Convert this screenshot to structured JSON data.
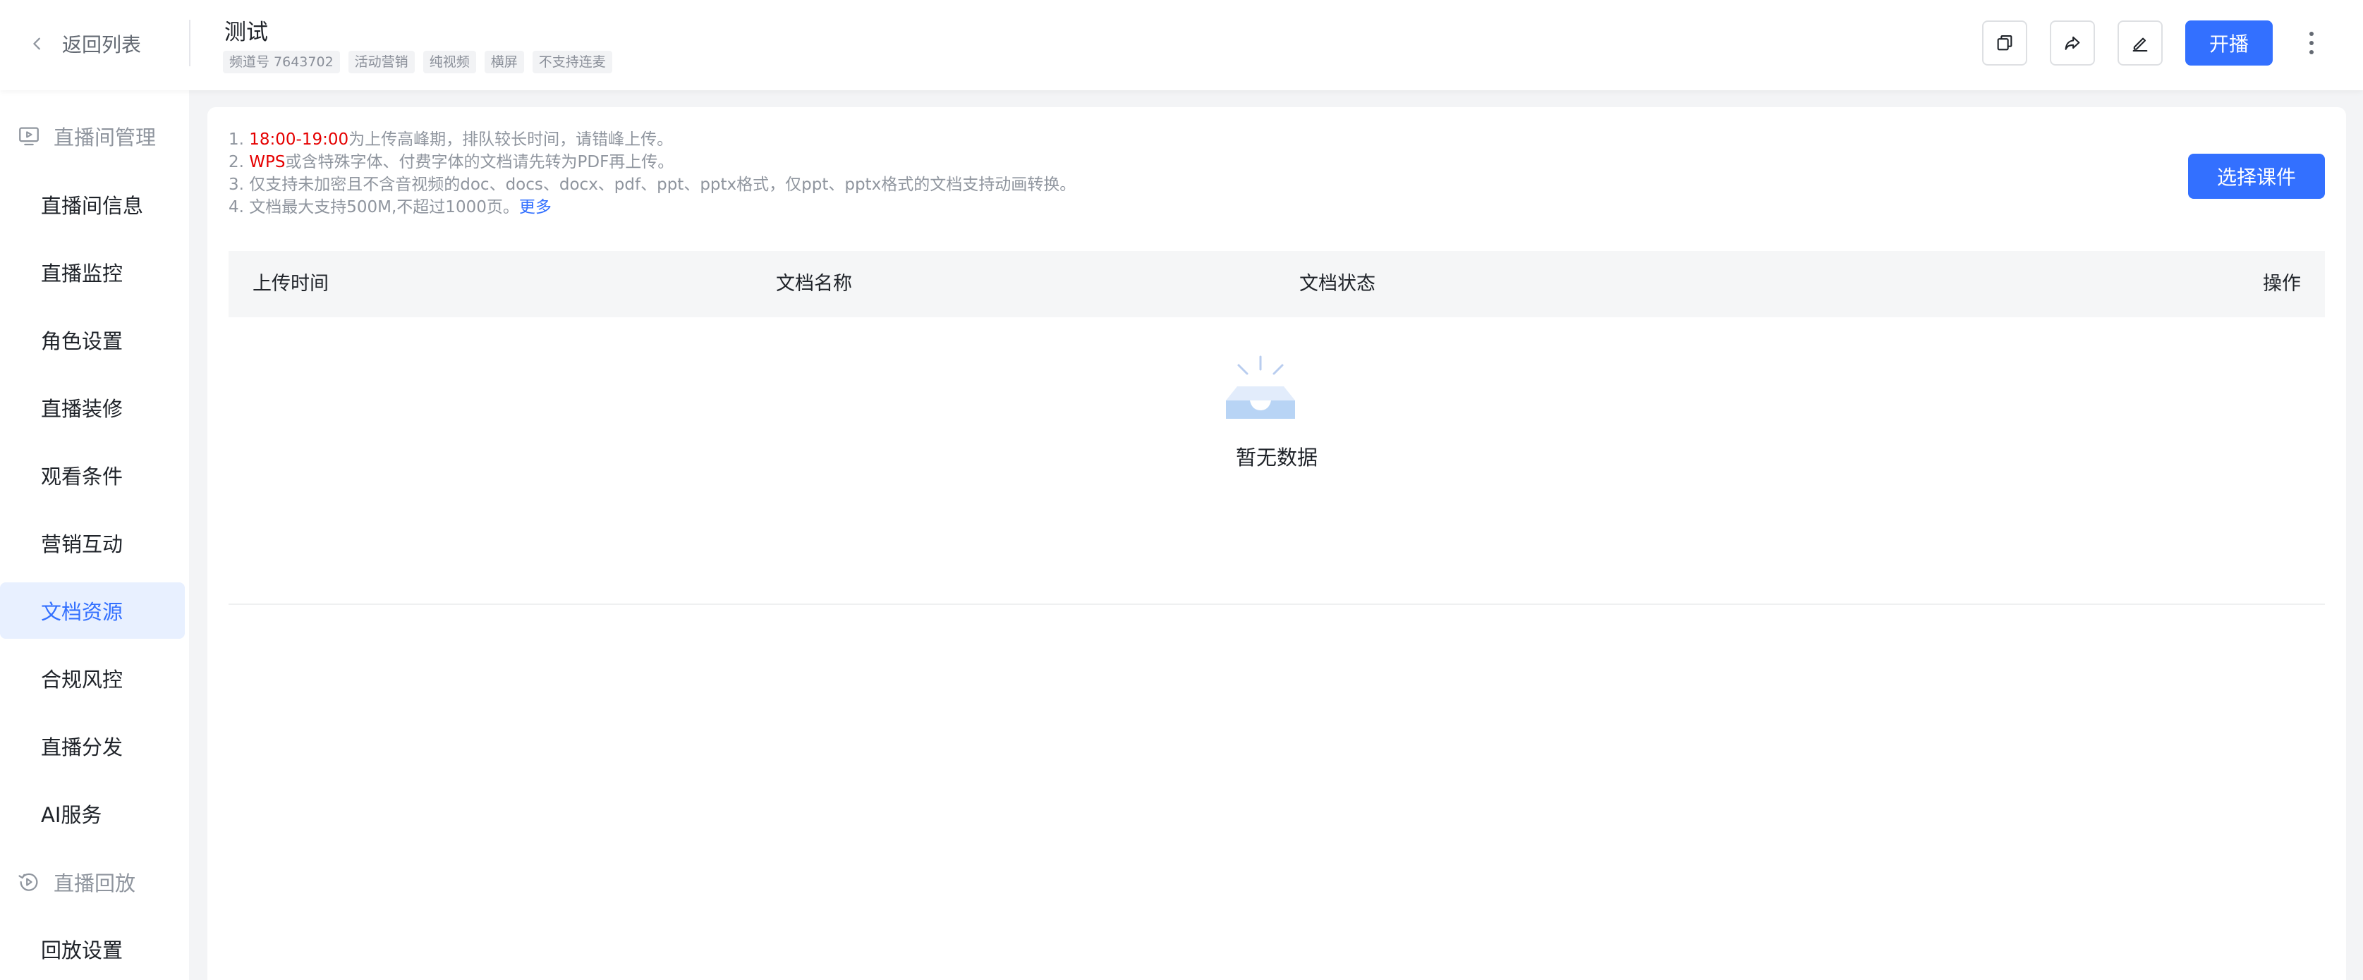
{
  "header": {
    "back_label": "返回列表",
    "title": "测试",
    "tags": [
      "频道号 7643702",
      "活动营销",
      "纯视频",
      "横屏",
      "不支持连麦"
    ],
    "start_label": "开播",
    "icons": [
      "copy-icon",
      "share-icon",
      "edit-icon",
      "more-icon"
    ]
  },
  "sidebar": {
    "group_live": "直播间管理",
    "items": [
      "直播间信息",
      "直播监控",
      "角色设置",
      "直播装修",
      "观看条件",
      "营销互动",
      "文档资源",
      "合规风控",
      "直播分发",
      "AI服务"
    ],
    "group_replay": "直播回放",
    "replay_items": [
      "回放设置"
    ],
    "active": "文档资源"
  },
  "main": {
    "tips": {
      "line1_prefix": "1. ",
      "line1_highlight": "18:00-19:00",
      "line1_rest": "为上传高峰期，排队较长时间，请错峰上传。",
      "line2_prefix": "2. ",
      "line2_highlight": "WPS",
      "line2_rest": "或含特殊字体、付费字体的文档请先转为PDF再上传。",
      "line3": "3. 仅支持未加密且不含音视频的doc、docs、docx、pdf、ppt、pptx格式，仅ppt、pptx格式的文档支持动画转换。",
      "line4": "4. 文档最大支持500M,不超过1000页。",
      "more_link": "更多"
    },
    "select_button": "选择课件",
    "table": {
      "columns": [
        "上传时间",
        "文档名称",
        "文档状态",
        "操作"
      ],
      "rows": []
    },
    "empty_text": "暂无数据"
  },
  "colors": {
    "primary": "#3370ff",
    "highlight_red": "#e50000",
    "active_bg": "#e8f0ff"
  }
}
